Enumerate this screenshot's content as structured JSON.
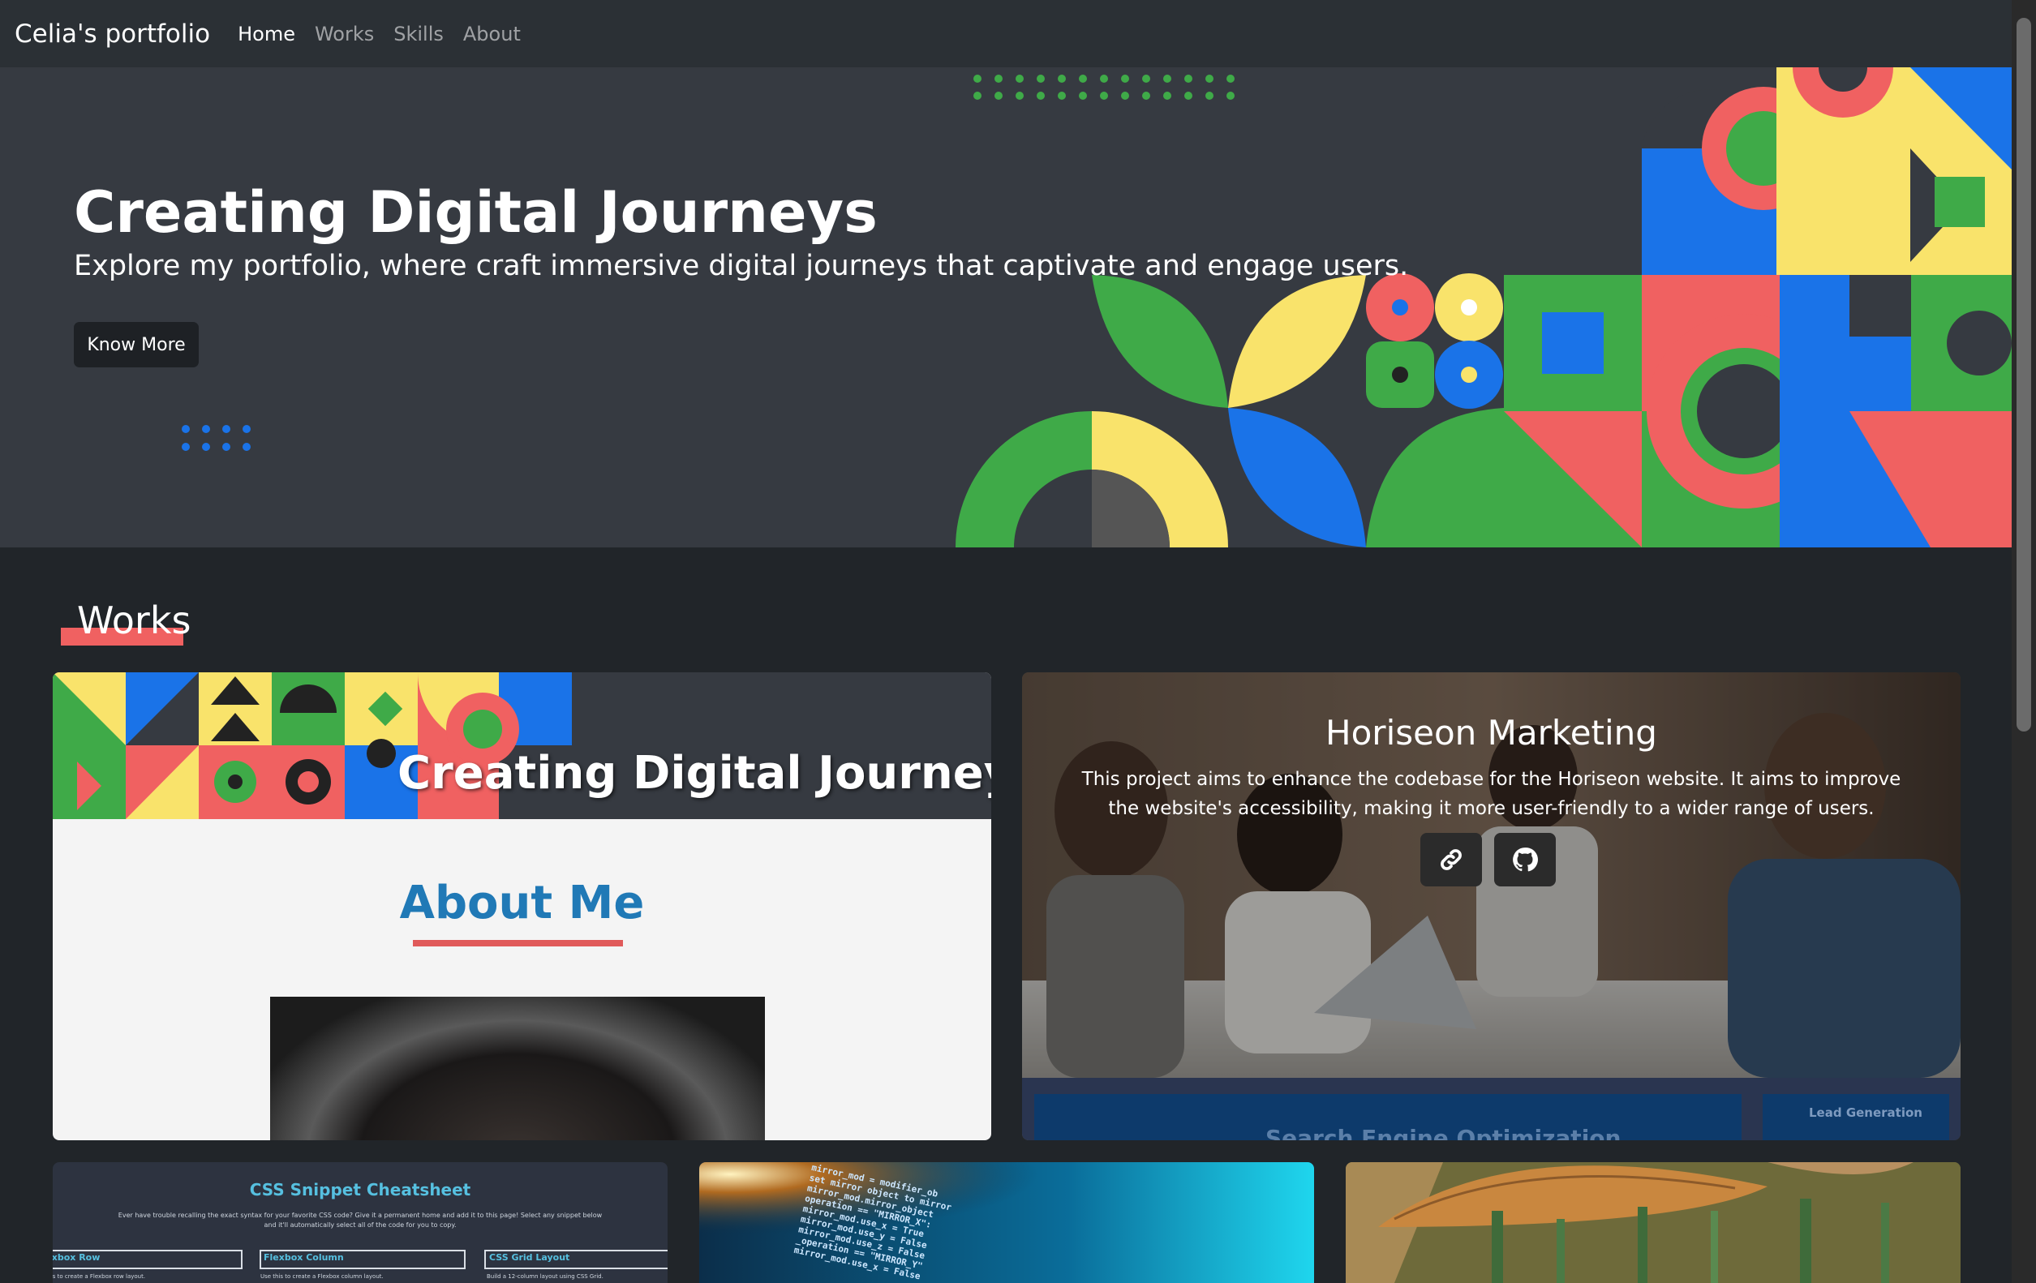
{
  "navbar": {
    "brand": "Celia's portfolio",
    "links": [
      "Home",
      "Works",
      "Skills",
      "About"
    ],
    "active": "Home"
  },
  "hero": {
    "title": "Creating Digital Journeys",
    "subtitle": "Explore my portfolio, where craft immersive digital journeys that captivate and engage users.",
    "button": "Know More"
  },
  "works": {
    "heading": "Works",
    "cards": [
      {
        "preview_title": "Creating Digital Journeys",
        "preview_heading": "About Me"
      },
      {
        "title": "Horiseon Marketing",
        "description": "This project aims to enhance the codebase for the Horiseon website. It aims to improve the website's accessibility, making it more user-friendly to a wider range of users.",
        "link_icon": "link-icon",
        "repo_icon": "github-icon",
        "preview_banner": "Search Engine Optimization",
        "preview_side": "Lead Generation"
      },
      {
        "preview_title": "CSS Snippet Cheatsheet",
        "preview_desc": "Ever have trouble recalling the exact syntax for your favorite CSS code? Give it a permanent home and add it to this page! Select any snippet below and it'll automatically select all of the code for you to copy.",
        "preview_items": [
          {
            "label": "Flexbox Row",
            "note": "Use these three properties to create a Flexbox row layout."
          },
          {
            "label": "Flexbox Column",
            "note": "Use this to create a Flexbox column layout."
          },
          {
            "label": "CSS Grid Layout",
            "note": "Build a 12-column layout using CSS Grid."
          }
        ]
      },
      {
        "preview_code": "mirror_mod = modifier_ob\nset mirror object to mirror\nmirror_mod.mirror_object\noperation == \"MIRROR_X\":\nmirror_mod.use_x = True\nmirror_mod.use_y = False\nmirror_mod.use_z = False\n_operation == \"MIRROR_Y\"\nmirror_mod.use_x = False"
      },
      {}
    ]
  },
  "colors": {
    "background": "#212529",
    "navbar": "#2b3035",
    "hero": "#363a41",
    "accent_red": "#f06161",
    "accent_blue": "#2079b6",
    "green": "#3faa48",
    "yellow": "#f9e36b",
    "blue": "#1a73e8"
  }
}
